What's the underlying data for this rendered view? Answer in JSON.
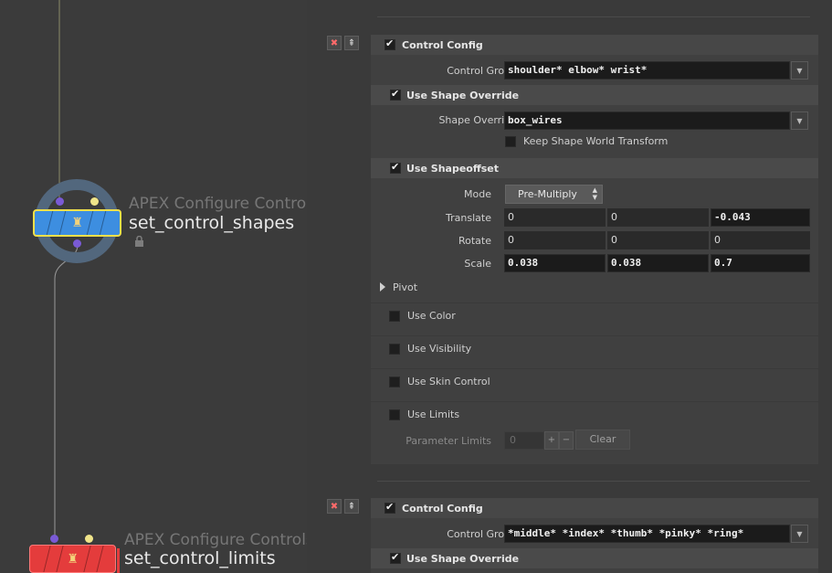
{
  "network": {
    "node1": {
      "type_label": "APEX Configure Controls",
      "name": "set_control_shapes",
      "color": "#3d8ee0",
      "selected": true,
      "locked": true
    },
    "node2": {
      "type_label": "APEX Configure Controls",
      "name": "set_control_limits",
      "color": "#e43c3c"
    }
  },
  "params": {
    "block1": {
      "remove_icon": "✖",
      "move_icon": "⇞",
      "control_config_label": "Control Config",
      "control_group_label": "Control Group",
      "control_group_value": "shoulder* elbow* wrist*",
      "use_shape_override_label": "Use Shape Override",
      "shape_override_label": "Shape Override",
      "shape_override_value": "box_wires",
      "keep_shape_world_label": "Keep Shape World Transform",
      "use_shapeoffset_label": "Use Shapeoffset",
      "mode_label": "Mode",
      "mode_value": "Pre-Multiply",
      "translate_label": "Translate",
      "translate": [
        "0",
        "0",
        "-0.043"
      ],
      "rotate_label": "Rotate",
      "rotate": [
        "0",
        "0",
        "0"
      ],
      "scale_label": "Scale",
      "scale": [
        "0.038",
        "0.038",
        "0.7"
      ],
      "pivot_label": "Pivot",
      "use_color_label": "Use Color",
      "use_visibility_label": "Use Visibility",
      "use_skin_control_label": "Use Skin Control",
      "use_limits_label": "Use Limits",
      "parameter_limits_label": "Parameter Limits",
      "parameter_limits_value": "0",
      "plus_label": "+",
      "minus_label": "−",
      "clear_label": "Clear"
    },
    "block2": {
      "remove_icon": "✖",
      "move_icon": "⇞",
      "control_config_label": "Control Config",
      "control_group_label": "Control Group",
      "control_group_value": "*middle* *index* *thumb* *pinky* *ring*",
      "use_shape_override_label": "Use Shape Override"
    }
  }
}
